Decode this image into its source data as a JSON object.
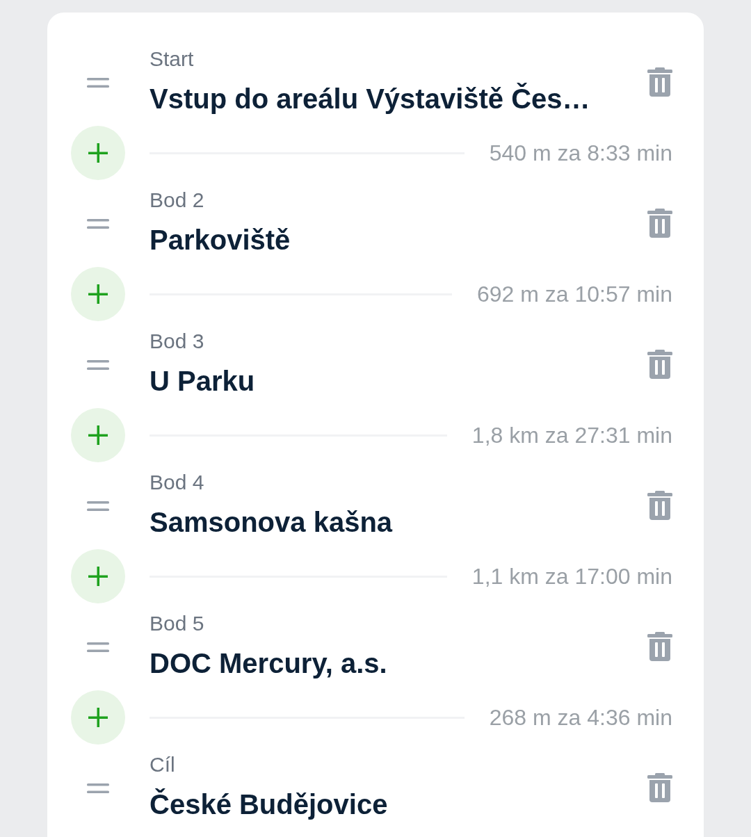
{
  "stops": [
    {
      "label": "Start",
      "title": "Vstup do areálu Výstaviště Čes…",
      "leg": "540 m za 8:33 min"
    },
    {
      "label": "Bod 2",
      "title": "Parkoviště",
      "leg": "692 m za 10:57 min"
    },
    {
      "label": "Bod 3",
      "title": "U Parku",
      "leg": "1,8 km za 27:31 min"
    },
    {
      "label": "Bod 4",
      "title": "Samsonova kašna",
      "leg": "1,1 km za 17:00 min"
    },
    {
      "label": "Bod 5",
      "title": "DOC Mercury, a.s.",
      "leg": "268 m za 4:36 min"
    },
    {
      "label": "Cíl",
      "title": "České Budějovice"
    }
  ]
}
